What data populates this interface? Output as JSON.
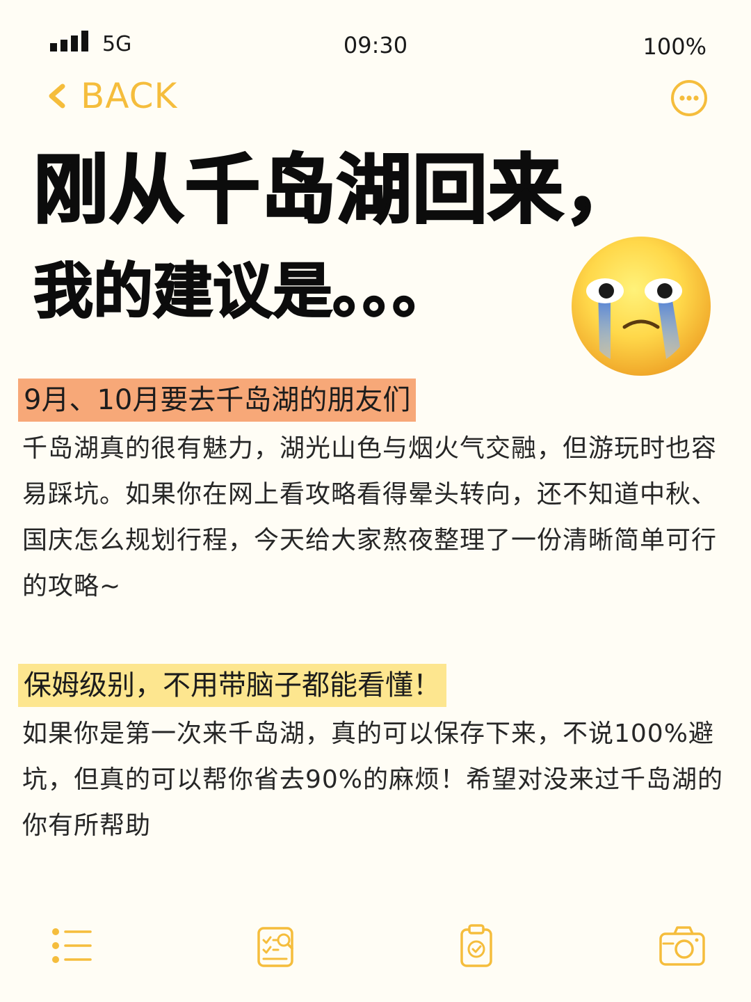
{
  "status_bar": {
    "network": "5G",
    "time": "09:30",
    "battery": "100%"
  },
  "nav": {
    "back_label": "BACK"
  },
  "headline": {
    "line1": "刚从千岛湖回来，",
    "line2": "我的建议是。。。"
  },
  "sections": [
    {
      "heading": "9月、10月要去千岛湖的朋友们",
      "heading_color": "#f7a878",
      "body": "千岛湖真的很有魅力，湖光山色与烟火气交融，但游玩时也容易踩坑。如果你在网上看攻略看得晕头转向，还不知道中秋、国庆怎么规划行程，今天给大家熬夜整理了一份清晰简单可行的攻略~"
    },
    {
      "heading": "保姆级别，不用带脑子都能看懂！",
      "heading_color": "#fde68f",
      "body": "如果你是第一次来千岛湖，真的可以保存下来，不说100%避坑，但真的可以帮你省去90%的麻烦！希望对没来过千岛湖的你有所帮助"
    }
  ],
  "tabs": [
    "list-icon",
    "checklist-icon",
    "clipboard-check-icon",
    "camera-icon"
  ],
  "colors": {
    "accent": "#f5bd3c",
    "background": "#fffdf5"
  }
}
